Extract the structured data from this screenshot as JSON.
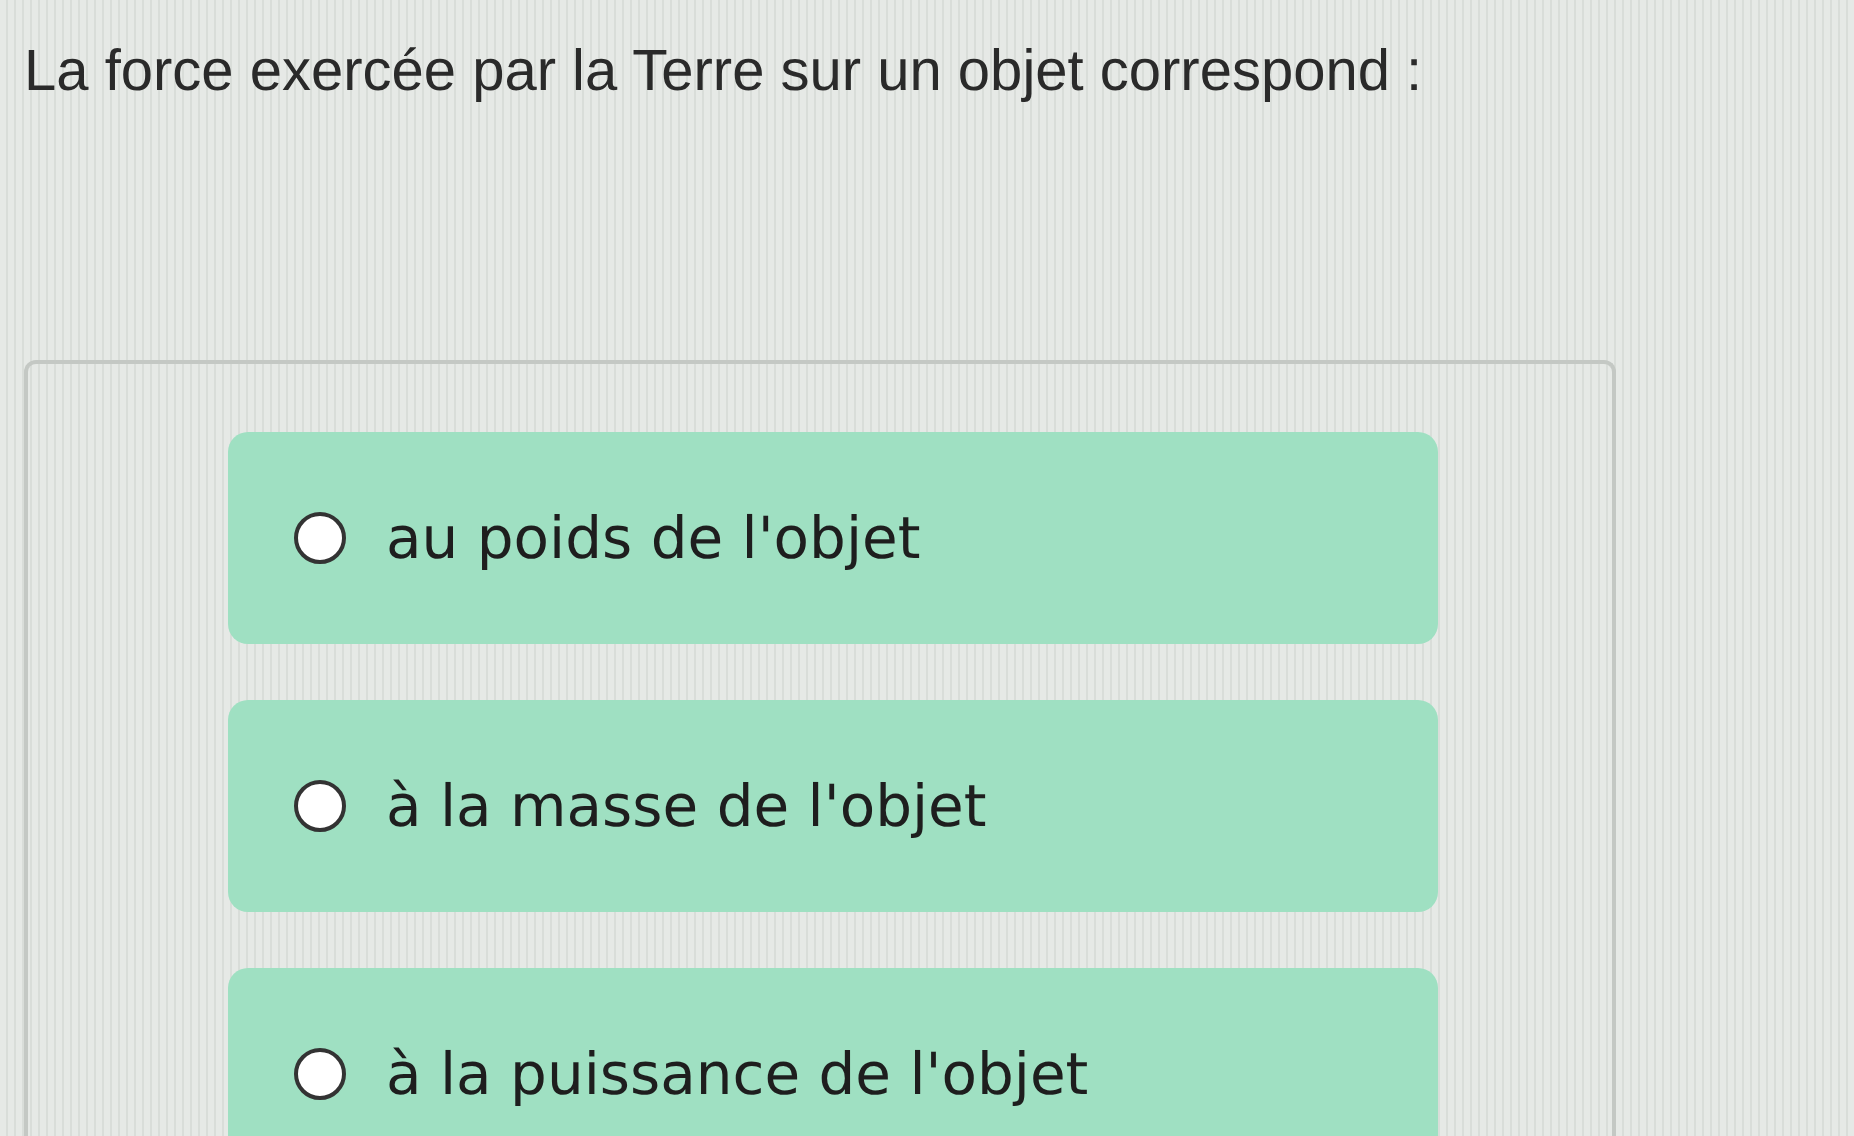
{
  "question": "La force exercée par la Terre sur un objet correspond :",
  "options": [
    {
      "label": "au poids de l'objet",
      "selected": false
    },
    {
      "label": "à la masse de l'objet",
      "selected": false
    },
    {
      "label": "à la puissance de l'objet",
      "selected": false
    }
  ]
}
